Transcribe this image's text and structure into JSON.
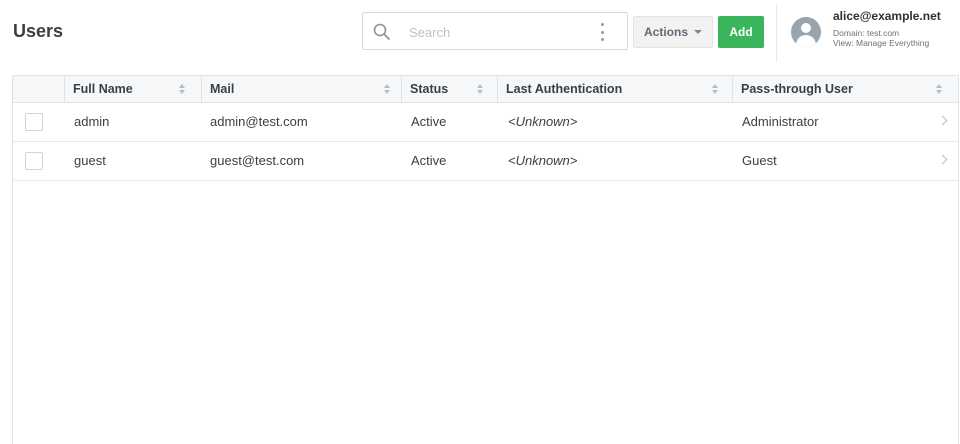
{
  "header": {
    "title": "Users",
    "search": {
      "placeholder": "Search",
      "value": ""
    },
    "actions_label": "Actions",
    "add_label": "Add"
  },
  "user": {
    "email": "alice@example.net",
    "domain": "Domain: test.com",
    "view": "View: Manage Everything"
  },
  "table": {
    "columns": [
      "Full Name",
      "Mail",
      "Status",
      "Last Authentication",
      "Pass-through User"
    ],
    "rows": [
      {
        "full_name": "admin",
        "mail": "admin@test.com",
        "status": "Active",
        "last_auth": "<Unknown>",
        "pass_through": "Administrator"
      },
      {
        "full_name": "guest",
        "mail": "guest@test.com",
        "status": "Active",
        "last_auth": "<Unknown>",
        "pass_through": "Guest"
      }
    ]
  },
  "colors": {
    "add_button": "#3bb55b",
    "header_bg": "#f6f7f8"
  }
}
